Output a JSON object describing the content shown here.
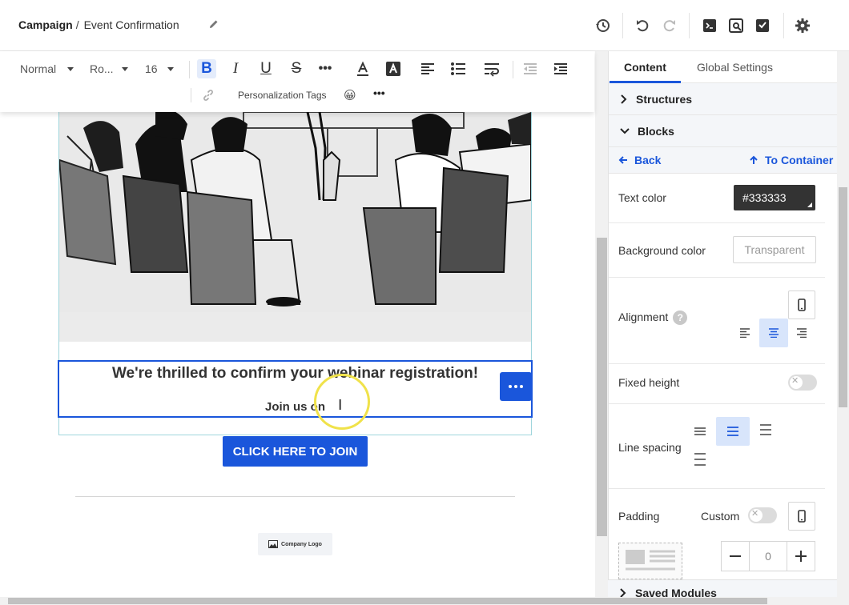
{
  "header": {
    "campaign": "Campaign",
    "separator": "/",
    "page_name": "Event Confirmation",
    "icons": [
      "edit-icon",
      "history-icon",
      "undo-icon",
      "redo-icon",
      "code-icon",
      "preview-icon",
      "test-email-icon",
      "settings-icon"
    ]
  },
  "toolbar": {
    "paragraph": "Normal",
    "font": "Ro...",
    "size": "16",
    "more": "•••",
    "personalization": "Personalization Tags",
    "emoji": "😀",
    "more2": "•••"
  },
  "email": {
    "heading": "We're thrilled to confirm your webinar registration!",
    "subtext": "Join us on",
    "cta": "CLICK HERE TO JOIN",
    "logo_text": "Company Logo"
  },
  "panel": {
    "tabs": [
      "Content",
      "Global Settings"
    ],
    "structures": "Structures",
    "blocks": "Blocks",
    "back": "Back",
    "to_container": "To Container",
    "text_color_label": "Text color",
    "text_color_value": "#333333",
    "bg_color_label": "Background color",
    "bg_color_placeholder": "Transparent",
    "alignment_label": "Alignment",
    "alignment_help": "?",
    "alignment_selected": "center",
    "fixed_height_label": "Fixed height",
    "fixed_height_on": false,
    "line_spacing_label": "Line spacing",
    "line_spacing_selected": 2,
    "padding_label": "Padding",
    "padding_custom": "Custom",
    "padding_custom_on": false,
    "stepper_value": "0",
    "saved_modules": "Saved Modules"
  },
  "colors": {
    "accent": "#1a56db",
    "text": "#333333",
    "cursor_highlight": "#f0e24a"
  }
}
